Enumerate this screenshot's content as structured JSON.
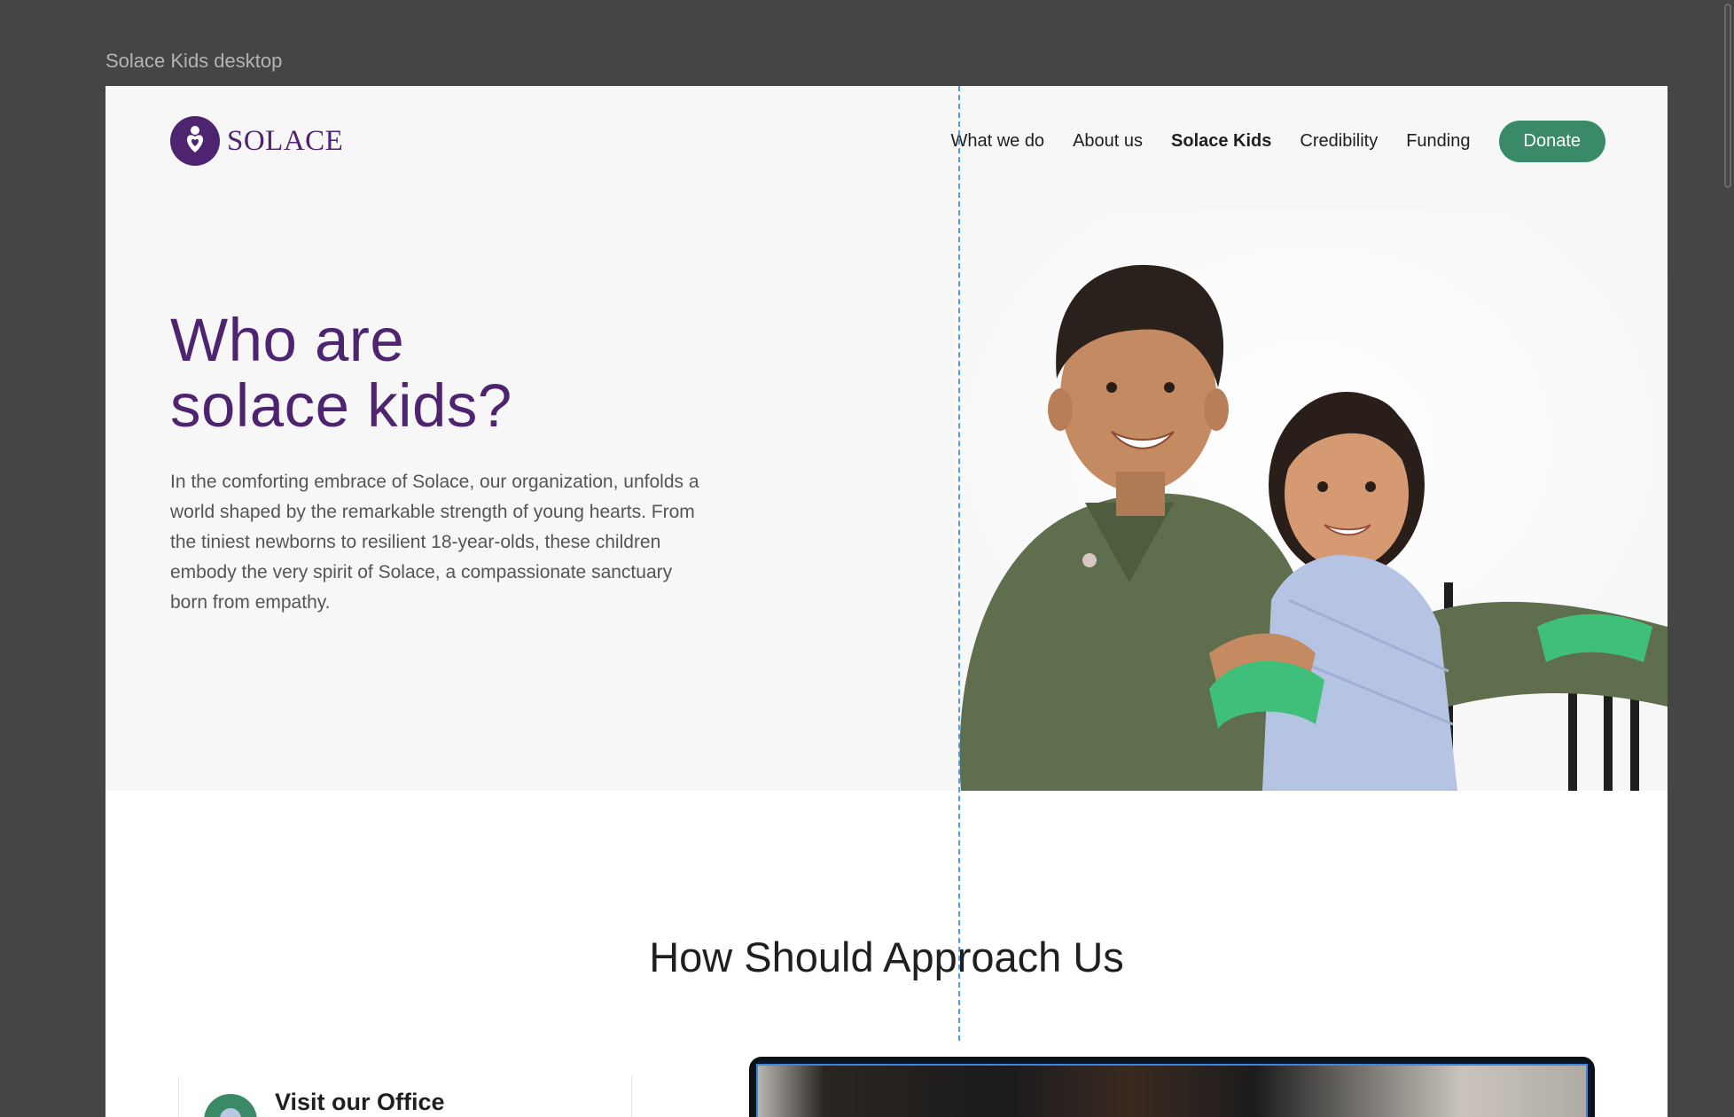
{
  "frame": {
    "label": "Solace Kids desktop"
  },
  "header": {
    "logo_text": "SOLACE",
    "nav": [
      {
        "label": "What we do",
        "active": false
      },
      {
        "label": "About us",
        "active": false
      },
      {
        "label": "Solace Kids",
        "active": true
      },
      {
        "label": "Credibility",
        "active": false
      },
      {
        "label": "Funding",
        "active": false
      }
    ],
    "donate_label": "Donate"
  },
  "hero": {
    "title_line1": "Who are",
    "title_line2": "solace kids?",
    "description": "In the comforting embrace of Solace, our organization, unfolds a world shaped by the remarkable strength of young hearts. From the tiniest newborns to resilient 18-year-olds, these children embody the very spirit of Solace, a compassionate sanctuary born from empathy."
  },
  "approach": {
    "title": "How Should Approach Us",
    "card_title": "Visit our Office"
  },
  "colors": {
    "brand_purple": "#4e2471",
    "accent_green": "#3b8a67",
    "guide_blue": "#4a9fe8",
    "frame_bg": "#454545"
  }
}
